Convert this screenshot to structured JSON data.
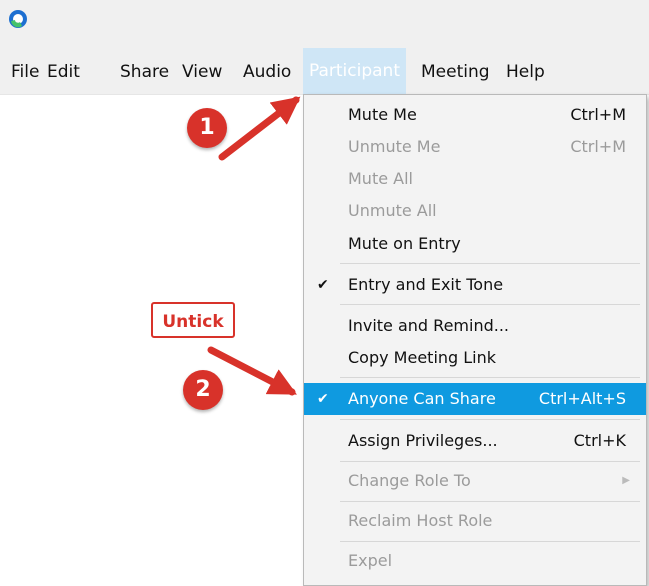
{
  "menubar": {
    "items": [
      {
        "label": "File"
      },
      {
        "label": "Edit"
      },
      {
        "label": "Share"
      },
      {
        "label": "View"
      },
      {
        "label": "Audio"
      },
      {
        "label": "Participant",
        "active": true
      },
      {
        "label": "Meeting"
      },
      {
        "label": "Help"
      }
    ]
  },
  "dropdown": {
    "items": [
      {
        "label": "Mute Me",
        "shortcut": "Ctrl+M",
        "enabled": true
      },
      {
        "label": "Unmute Me",
        "shortcut": "Ctrl+M",
        "enabled": false
      },
      {
        "label": "Mute All",
        "shortcut": "",
        "enabled": false
      },
      {
        "label": "Unmute All",
        "shortcut": "",
        "enabled": false
      },
      {
        "label": "Mute on Entry",
        "shortcut": "",
        "enabled": true
      },
      {
        "label": "Entry and Exit Tone",
        "shortcut": "",
        "enabled": true,
        "checked": true
      },
      {
        "label": "Invite and Remind...",
        "shortcut": "",
        "enabled": true
      },
      {
        "label": "Copy Meeting Link",
        "shortcut": "",
        "enabled": true
      },
      {
        "label": "Anyone Can Share",
        "shortcut": "Ctrl+Alt+S",
        "enabled": true,
        "checked": true,
        "highlighted": true
      },
      {
        "label": "Assign Privileges...",
        "shortcut": "Ctrl+K",
        "enabled": true
      },
      {
        "label": "Change Role To",
        "shortcut": "",
        "enabled": false,
        "submenu": true
      },
      {
        "label": "Reclaim Host Role",
        "shortcut": "",
        "enabled": false
      },
      {
        "label": "Expel",
        "shortcut": "",
        "enabled": false
      }
    ]
  },
  "annotations": {
    "step1": "1",
    "step2": "2",
    "untick_label": "Untick"
  },
  "colors": {
    "highlight": "#0f9ae0",
    "annotation_red": "#d8322a",
    "active_menu_bg": "#cfe6f6"
  },
  "icons": {
    "app_logo": "webex-logo-icon",
    "check": "checkmark-icon",
    "submenu": "chevron-right-icon"
  }
}
